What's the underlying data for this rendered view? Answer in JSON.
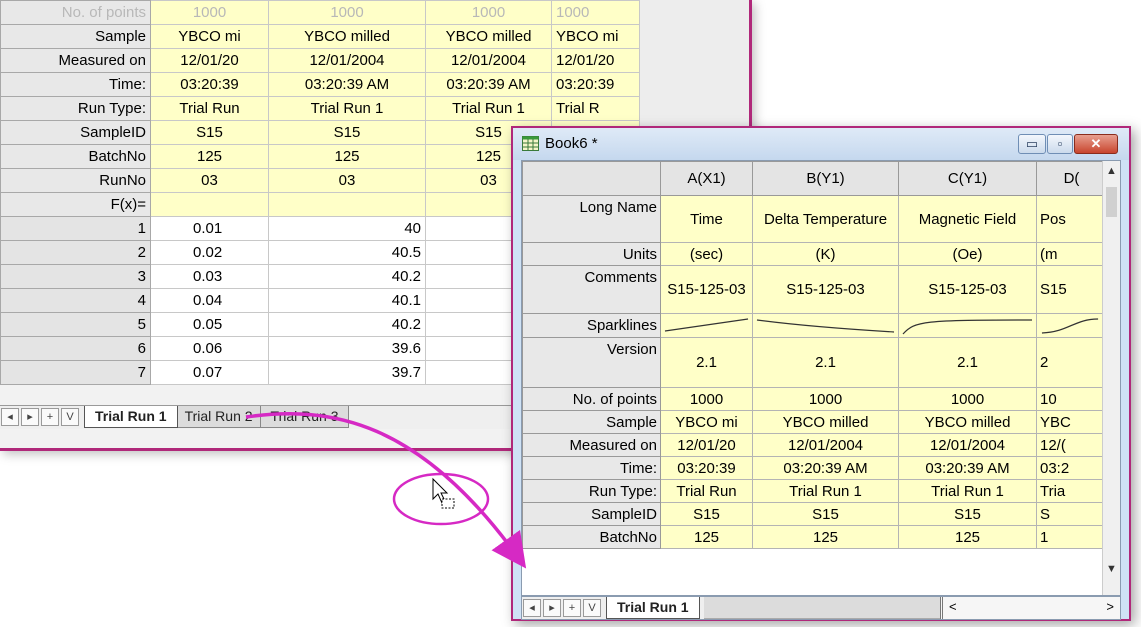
{
  "back": {
    "labels": [
      "No. of points",
      "Sample",
      "Measured on",
      "Time:",
      "Run Type:",
      "SampleID",
      "BatchNo",
      "RunNo",
      "F(x)="
    ],
    "row_cols": [
      [
        "1000",
        "1000",
        "1000",
        "1000"
      ],
      [
        "YBCO mi",
        "YBCO milled",
        "YBCO milled",
        "YBCO mi"
      ],
      [
        "12/01/20",
        "12/01/2004",
        "12/01/2004",
        "12/01/20"
      ],
      [
        "03:20:39",
        "03:20:39 AM",
        "03:20:39 AM",
        "03:20:39"
      ],
      [
        "Trial Run",
        "Trial Run 1",
        "Trial Run 1",
        "Trial R"
      ],
      [
        "S15",
        "S15",
        "S15",
        ""
      ],
      [
        "125",
        "125",
        "125",
        ""
      ],
      [
        "03",
        "03",
        "03",
        ""
      ],
      [
        "",
        "",
        "",
        ""
      ]
    ],
    "data_rows": [
      {
        "n": "1",
        "a": "0.01",
        "b": "40"
      },
      {
        "n": "2",
        "a": "0.02",
        "b": "40.5"
      },
      {
        "n": "3",
        "a": "0.03",
        "b": "40.2"
      },
      {
        "n": "4",
        "a": "0.04",
        "b": "40.1"
      },
      {
        "n": "5",
        "a": "0.05",
        "b": "40.2"
      },
      {
        "n": "6",
        "a": "0.06",
        "b": "39.6"
      },
      {
        "n": "7",
        "a": "0.07",
        "b": "39.7"
      }
    ],
    "tabs": [
      "Trial Run 1",
      "Trial Run 2",
      "Trial Run 3"
    ],
    "nav": [
      "◂",
      "▸",
      "+",
      "V"
    ]
  },
  "front": {
    "title": "Book6 *",
    "win_buttons": {
      "min": "▭",
      "max": "▫",
      "close": "✕"
    },
    "columns": [
      "A(X1)",
      "B(Y1)",
      "C(Y1)",
      "D("
    ],
    "rows": [
      {
        "label": "Long Name",
        "cells": [
          "Time",
          "Delta Temperature",
          "Magnetic Field",
          "Pos"
        ]
      },
      {
        "label": "Units",
        "cells": [
          "(sec)",
          "(K)",
          "(Oe)",
          "(m"
        ]
      },
      {
        "label": "Comments",
        "cells": [
          "S15-125-03",
          "S15-125-03",
          "S15-125-03",
          "S15"
        ]
      },
      {
        "label": "Sparklines",
        "cells": [
          "",
          "",
          "",
          ""
        ]
      },
      {
        "label": "Version",
        "cells": [
          "2.1",
          "2.1",
          "2.1",
          "2"
        ]
      },
      {
        "label": "No. of points",
        "cells": [
          "1000",
          "1000",
          "1000",
          "10"
        ]
      },
      {
        "label": "Sample",
        "cells": [
          "YBCO mi",
          "YBCO milled",
          "YBCO milled",
          "YBC"
        ]
      },
      {
        "label": "Measured on",
        "cells": [
          "12/01/20",
          "12/01/2004",
          "12/01/2004",
          "12/("
        ]
      },
      {
        "label": "Time:",
        "cells": [
          "03:20:39",
          "03:20:39 AM",
          "03:20:39 AM",
          "03:2"
        ]
      },
      {
        "label": "Run Type:",
        "cells": [
          "Trial Run",
          "Trial Run 1",
          "Trial Run 1",
          "Tria"
        ]
      },
      {
        "label": "SampleID",
        "cells": [
          "S15",
          "S15",
          "S15",
          "S"
        ]
      },
      {
        "label": "BatchNo",
        "cells": [
          "125",
          "125",
          "125",
          "1"
        ]
      }
    ],
    "tab": "Trial Run 1",
    "nav": [
      "◂",
      "▸",
      "+",
      "V"
    ],
    "hscroll": {
      "left": "<",
      "right": ">"
    }
  },
  "colors": {
    "accent": "#b0287a",
    "yellow": "#ffffc8",
    "arrow": "#d629c4"
  }
}
